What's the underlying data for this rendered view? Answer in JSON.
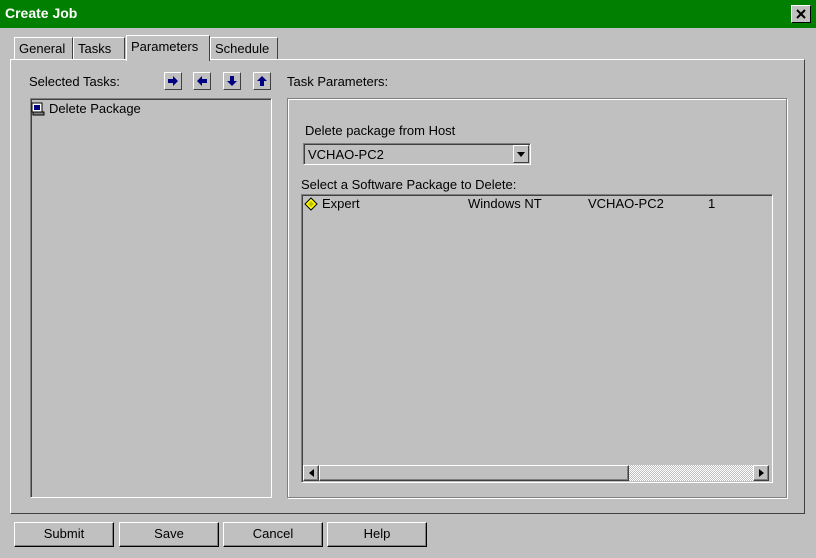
{
  "window": {
    "title": "Create Job"
  },
  "tabs": [
    {
      "label": "General"
    },
    {
      "label": "Tasks"
    },
    {
      "label": "Parameters"
    },
    {
      "label": "Schedule"
    }
  ],
  "left": {
    "selected_tasks_label": "Selected Tasks:",
    "tasks": [
      {
        "label": "Delete Package",
        "icon": "package-icon"
      }
    ]
  },
  "right": {
    "task_parameters_label": "Task Parameters:",
    "host_label": "Delete package from Host",
    "host_value": "VCHAO-PC2",
    "package_list_label": "Select a Software Package to Delete:",
    "packages": [
      {
        "name": "Expert",
        "os": "Windows NT",
        "host": "VCHAO-PC2",
        "version": "1"
      }
    ]
  },
  "buttons": {
    "submit": "Submit",
    "save": "Save",
    "cancel": "Cancel",
    "help": "Help"
  },
  "colors": {
    "titlebar": "#007f00",
    "face": "#c0c0c0",
    "arrow": "#000080"
  }
}
